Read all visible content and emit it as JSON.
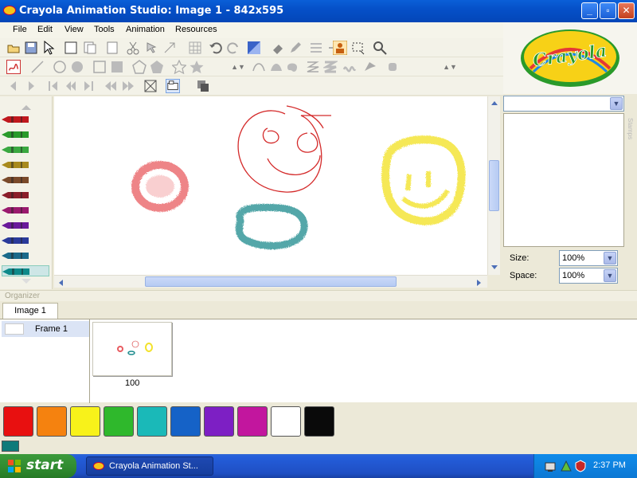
{
  "window": {
    "title": "Crayola Animation Studio: Image 1 - 842x595",
    "minimize_glyph": "_",
    "maximize_glyph": "▫",
    "close_glyph": "✕"
  },
  "menu": [
    "File",
    "Edit",
    "View",
    "Tools",
    "Animation",
    "Resources"
  ],
  "toolbar": {
    "shape_size_value": "5",
    "brush_size_value": "16"
  },
  "logo": {
    "text": "Crayola"
  },
  "stamps": {
    "panel_label": "Stamps",
    "size_label": "Size:",
    "size_value": "100%",
    "space_label": "Space:",
    "space_value": "100%",
    "dropdown_arrow": "▼"
  },
  "organizer": {
    "header_label": "Organizer",
    "tab_label": "Image 1",
    "frame_label": "Frame 1",
    "thumb_value": "100"
  },
  "palette": {
    "colors": [
      "#e81010",
      "#f5820f",
      "#f8f21a",
      "#2fb82c",
      "#1ab9b8",
      "#1562c7",
      "#7d1fc4",
      "#c2169e",
      "#ffffff",
      "#0a0a0a"
    ],
    "current_color": "#0e7a7a"
  },
  "crayons": [
    "#c0181d",
    "#2a9a2a",
    "#3aa840",
    "#a88a1e",
    "#7a4a2a",
    "#8a1e2a",
    "#9a1a6e",
    "#6a1a9a",
    "#2a3a9a",
    "#1a6a8a",
    "#0e8a8a"
  ],
  "taskbar": {
    "start_label": "start",
    "task_label": "Crayola Animation St...",
    "clock": "2:37 PM"
  }
}
